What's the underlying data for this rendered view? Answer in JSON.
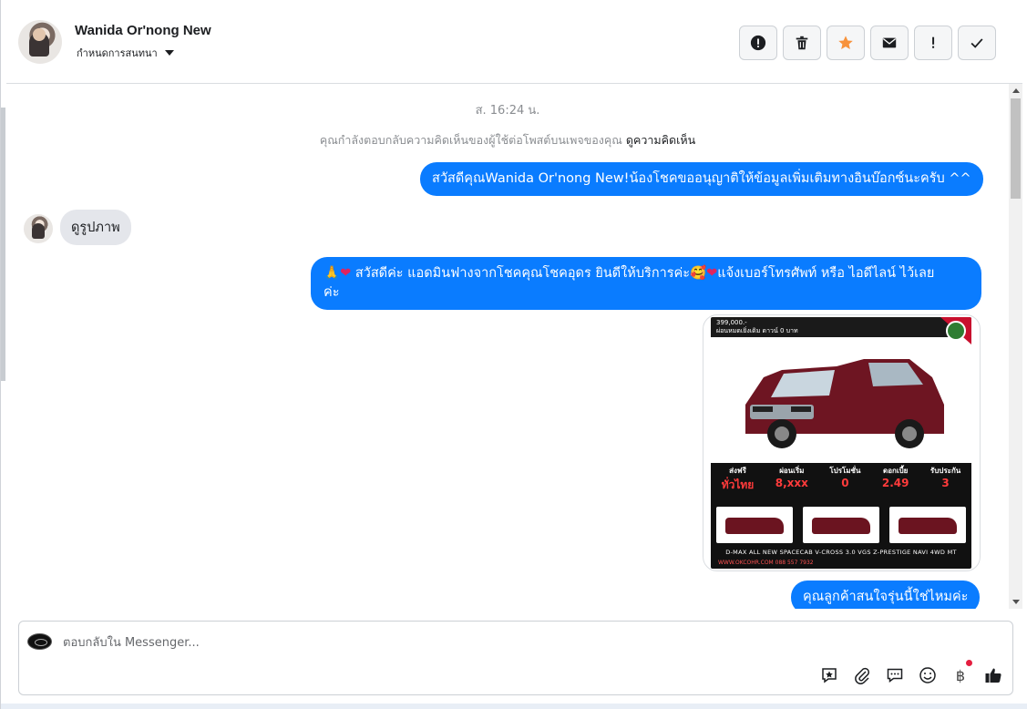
{
  "header": {
    "contact_name": "Wanida Or'nong New",
    "assign_label": "กำหนดการสนทนา"
  },
  "toolbar": {
    "items": [
      {
        "name": "spam",
        "icon": "alert-circle-icon"
      },
      {
        "name": "delete",
        "icon": "trash-icon"
      },
      {
        "name": "star",
        "icon": "star-icon",
        "color": "#f7923b"
      },
      {
        "name": "mark-unread",
        "icon": "envelope-icon"
      },
      {
        "name": "follow-up",
        "icon": "exclamation-icon"
      },
      {
        "name": "done",
        "icon": "check-icon"
      }
    ]
  },
  "chat": {
    "timestamp": "ส. 16:24 น.",
    "context_text": "คุณกำลังตอบกลับความคิดเห็นของผู้ใช้ต่อโพสต์บนเพจของคุณ",
    "context_link": "ดูความคิดเห็น",
    "messages": [
      {
        "direction": "out",
        "text": "สวัสดีคุณWanida Or'nong New!น้องโชคขออนุญาติให้ข้อมูลเพิ่มเติมทางอินบ๊อกซ์นะครับ ^^"
      },
      {
        "direction": "in",
        "text": "ดูรูปภาพ"
      },
      {
        "direction": "out",
        "line1_a": "🙏",
        "line1_b": "❤",
        "line1_c": " สวัสดีค่ะ แอดมินฟางจากโชคคุณโชคอุดร ยินดีให้บริการค่ะ",
        "line1_d": "🥰",
        "line1_e": "❤",
        "line1_f": "แจ้งเบอร์โทรศัพท์ หรือ ไอดีไลน์  ไว้เลย",
        "line2": "ค่ะ"
      },
      {
        "direction": "out",
        "text": "คุณลูกค้าสนใจรุ่นนี้ใช่ไหมค่ะ"
      }
    ],
    "image_card": {
      "price": "399,000.-",
      "price_sub": "ผ่อนหมดเยิ่งเดิม ดาวน์ 0 บาท",
      "stats": [
        {
          "label": "ส่งฟรี",
          "value": "ทั่วไทย"
        },
        {
          "label": "ผ่อนเริ่ม",
          "value": "8,xxx"
        },
        {
          "label": "โปรโมชั่น",
          "value": "0"
        },
        {
          "label": "ดอกเบี้ย",
          "value": "2.49"
        },
        {
          "label": "รับประกัน",
          "value": "3"
        }
      ],
      "caption": "D-MAX ALL NEW SPACECAB V-CROSS 3.0 VGS Z-PRESTIGE NAVI 4WD MT",
      "contact": "WWW.OKCOHR.COM 088 557 7932"
    }
  },
  "composer": {
    "placeholder": "ตอบกลับใน Messenger...",
    "icons": [
      "saved-reply-icon",
      "attachment-icon",
      "chat-bubble-icon",
      "emoji-icon",
      "baht-icon",
      "thumbs-up-icon"
    ],
    "baht_symbol": "฿"
  }
}
